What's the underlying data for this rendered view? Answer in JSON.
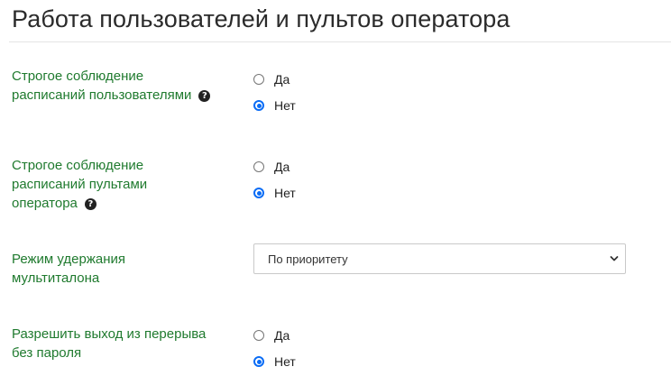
{
  "page": {
    "title": "Работа пользователей и пультов оператора"
  },
  "settings": [
    {
      "label_lines": [
        "Строгое соблюдение",
        "расписаний пользователями"
      ],
      "help_icon": "question-circle-icon",
      "options": [
        {
          "label": "Да",
          "checked": false
        },
        {
          "label": "Нет",
          "checked": true
        }
      ]
    },
    {
      "label_lines": [
        "Строгое соблюдение",
        "расписаний пультами",
        "оператора"
      ],
      "help_icon": "question-circle-icon",
      "options": [
        {
          "label": "Да",
          "checked": false
        },
        {
          "label": "Нет",
          "checked": true
        }
      ]
    },
    {
      "label_lines": [
        "Режим удержания",
        "мультиталона"
      ],
      "select_value": "По приоритету"
    },
    {
      "label_lines": [
        "Разрешить выход из перерыва",
        "без пароля"
      ],
      "options": [
        {
          "label": "Да",
          "checked": false
        },
        {
          "label": "Нет",
          "checked": true
        }
      ]
    }
  ],
  "colors": {
    "label_green": "#1f7a2e",
    "radio_accent": "#0a6cf5",
    "title_text": "#2b2b2b"
  }
}
